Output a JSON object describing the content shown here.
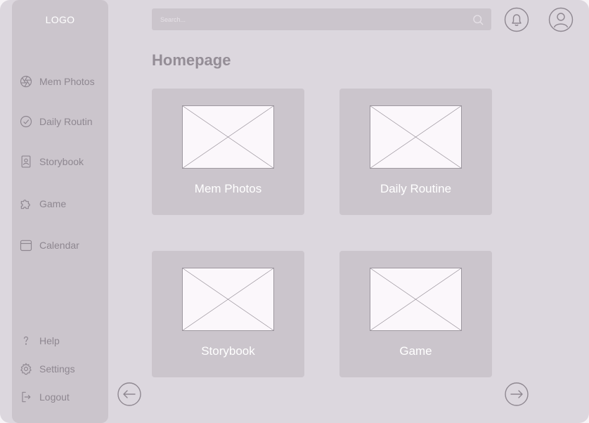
{
  "sidebar": {
    "logo": "LOGO",
    "items": [
      {
        "label": "Mem Photos",
        "icon": "aperture-icon"
      },
      {
        "label": "Daily Routin",
        "icon": "check-circle-icon"
      },
      {
        "label": "Storybook",
        "icon": "book-icon"
      },
      {
        "label": "Game",
        "icon": "puzzle-icon"
      },
      {
        "label": "Calendar",
        "icon": "calendar-icon"
      }
    ],
    "bottom": [
      {
        "label": "Help",
        "icon": "question-icon"
      },
      {
        "label": "Settings",
        "icon": "gear-icon"
      },
      {
        "label": "Logout",
        "icon": "logout-icon"
      }
    ]
  },
  "header": {
    "search_placeholder": "Search...",
    "search_icon": "search-icon",
    "notification_icon": "bell-icon",
    "profile_icon": "user-icon"
  },
  "main": {
    "title": "Homepage",
    "cards": [
      {
        "label": "Mem Photos"
      },
      {
        "label": "Daily Routine"
      },
      {
        "label": "Storybook"
      },
      {
        "label": "Game"
      }
    ]
  },
  "pagination": {
    "prev_icon": "arrow-left-icon",
    "next_icon": "arrow-right-icon"
  },
  "colors": {
    "background": "#dcd7de",
    "panel": "#cbc5cc",
    "muted_text": "#8e8790",
    "title_text": "#948d96",
    "placeholder_fill": "#fbf7fb"
  }
}
